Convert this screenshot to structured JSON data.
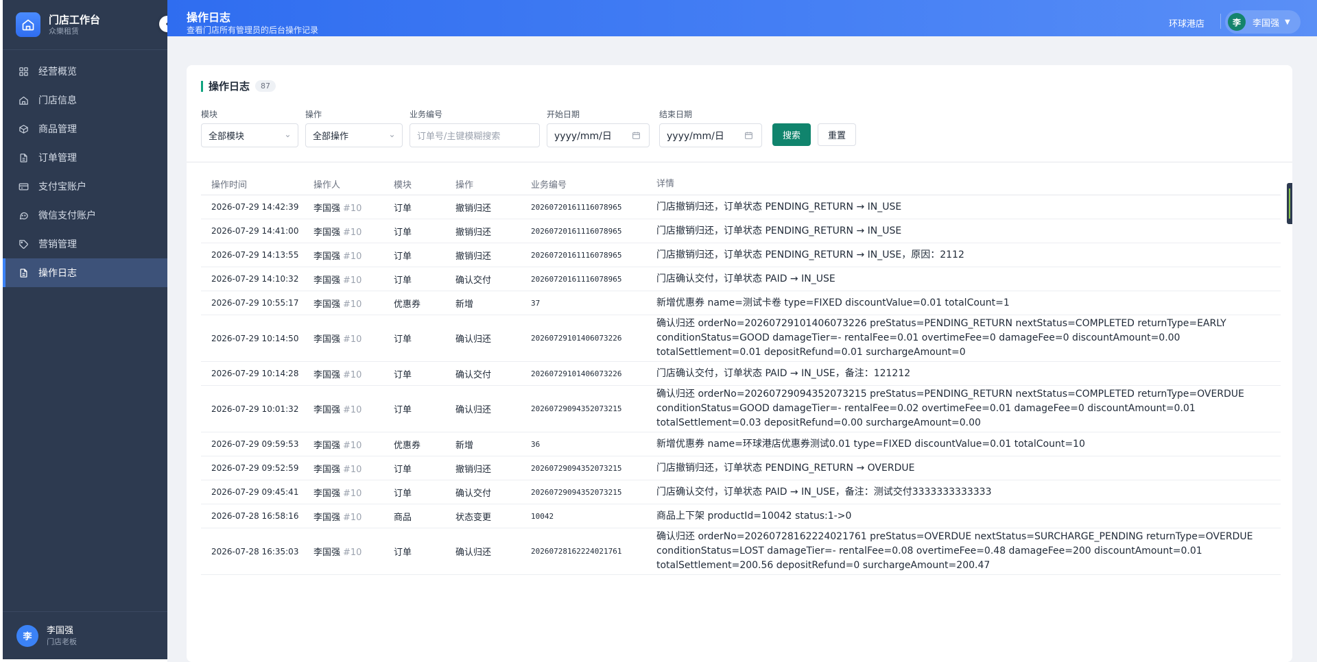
{
  "brand": {
    "title": "门店工作台",
    "subtitle": "众樂租赁"
  },
  "sidebar": {
    "items": [
      {
        "label": "经营概览",
        "icon": "grid-icon"
      },
      {
        "label": "门店信息",
        "icon": "home-icon"
      },
      {
        "label": "商品管理",
        "icon": "box-icon"
      },
      {
        "label": "订单管理",
        "icon": "document-icon"
      },
      {
        "label": "支付宝账户",
        "icon": "card-icon"
      },
      {
        "label": "微信支付账户",
        "icon": "chat-icon"
      },
      {
        "label": "营销管理",
        "icon": "tag-icon"
      },
      {
        "label": "操作日志",
        "icon": "log-icon",
        "active": true
      }
    ],
    "user": {
      "avatar": "李",
      "name": "李国强",
      "role": "门店老板"
    }
  },
  "header": {
    "title": "操作日志",
    "subtitle": "查看门店所有管理员的后台操作记录",
    "store": "环球港店",
    "user": {
      "avatar": "李",
      "name": "李国强",
      "caret": "▼"
    }
  },
  "card": {
    "title": "操作日志",
    "count": "87"
  },
  "filters": {
    "module": {
      "label": "模块",
      "value": "全部模块"
    },
    "action": {
      "label": "操作",
      "value": "全部操作"
    },
    "biz": {
      "label": "业务编号",
      "placeholder": "订单号/主键模糊搜索"
    },
    "start": {
      "label": "开始日期",
      "placeholder": "yyyy/mm/日"
    },
    "end": {
      "label": "结束日期",
      "placeholder": "yyyy/mm/日"
    },
    "search_label": "搜索",
    "reset_label": "重置"
  },
  "table": {
    "columns": [
      "操作时间",
      "操作人",
      "模块",
      "操作",
      "业务编号",
      "详情"
    ],
    "rows": [
      {
        "time": "2026-07-29 14:42:39",
        "operator": "李国强",
        "opid": "#10",
        "module": "订单",
        "action": "撤销归还",
        "biz": "20260720161116078965",
        "detail": "门店撤销归还，订单状态 PENDING_RETURN → IN_USE"
      },
      {
        "time": "2026-07-29 14:41:00",
        "operator": "李国强",
        "opid": "#10",
        "module": "订单",
        "action": "撤销归还",
        "biz": "20260720161116078965",
        "detail": "门店撤销归还，订单状态 PENDING_RETURN → IN_USE"
      },
      {
        "time": "2026-07-29 14:13:55",
        "operator": "李国强",
        "opid": "#10",
        "module": "订单",
        "action": "撤销归还",
        "biz": "20260720161116078965",
        "detail": "门店撤销归还，订单状态 PENDING_RETURN → IN_USE，原因：2112"
      },
      {
        "time": "2026-07-29 14:10:32",
        "operator": "李国强",
        "opid": "#10",
        "module": "订单",
        "action": "确认交付",
        "biz": "20260720161116078965",
        "detail": "门店确认交付，订单状态 PAID → IN_USE"
      },
      {
        "time": "2026-07-29 10:55:17",
        "operator": "李国强",
        "opid": "#10",
        "module": "优惠券",
        "action": "新增",
        "biz": "37",
        "detail": "新增优惠券 name=测试卡卷 type=FIXED discountValue=0.01 totalCount=1"
      },
      {
        "time": "2026-07-29 10:14:50",
        "operator": "李国强",
        "opid": "#10",
        "module": "订单",
        "action": "确认归还",
        "biz": "20260729101406073226",
        "detail": "确认归还 orderNo=20260729101406073226 preStatus=PENDING_RETURN nextStatus=COMPLETED returnType=EARLY conditionStatus=GOOD damageTier=- rentalFee=0.01 overtimeFee=0 damageFee=0 discountAmount=0.00 totalSettlement=0.01 depositRefund=0.01 surchargeAmount=0"
      },
      {
        "time": "2026-07-29 10:14:28",
        "operator": "李国强",
        "opid": "#10",
        "module": "订单",
        "action": "确认交付",
        "biz": "20260729101406073226",
        "detail": "门店确认交付，订单状态 PAID → IN_USE，备注：121212"
      },
      {
        "time": "2026-07-29 10:01:32",
        "operator": "李国强",
        "opid": "#10",
        "module": "订单",
        "action": "确认归还",
        "biz": "20260729094352073215",
        "detail": "确认归还 orderNo=20260729094352073215 preStatus=PENDING_RETURN nextStatus=COMPLETED returnType=OVERDUE conditionStatus=GOOD damageTier=- rentalFee=0.02 overtimeFee=0.01 damageFee=0 discountAmount=0.01 totalSettlement=0.03 depositRefund=0.00 surchargeAmount=0.00"
      },
      {
        "time": "2026-07-29 09:59:53",
        "operator": "李国强",
        "opid": "#10",
        "module": "优惠券",
        "action": "新增",
        "biz": "36",
        "detail": "新增优惠券 name=环球港店优惠券测试0.01 type=FIXED discountValue=0.01 totalCount=10"
      },
      {
        "time": "2026-07-29 09:52:59",
        "operator": "李国强",
        "opid": "#10",
        "module": "订单",
        "action": "撤销归还",
        "biz": "20260729094352073215",
        "detail": "门店撤销归还，订单状态 PENDING_RETURN → OVERDUE"
      },
      {
        "time": "2026-07-29 09:45:41",
        "operator": "李国强",
        "opid": "#10",
        "module": "订单",
        "action": "确认交付",
        "biz": "20260729094352073215",
        "detail": "门店确认交付，订单状态 PAID → IN_USE，备注：测试交付3333333333333"
      },
      {
        "time": "2026-07-28 16:58:16",
        "operator": "李国强",
        "opid": "#10",
        "module": "商品",
        "action": "状态变更",
        "biz": "10042",
        "detail": "商品上下架 productId=10042 status:1->0"
      },
      {
        "time": "2026-07-28 16:35:03",
        "operator": "李国强",
        "opid": "#10",
        "module": "订单",
        "action": "确认归还",
        "biz": "20260728162224021761",
        "detail": "确认归还 orderNo=20260728162224021761 preStatus=OVERDUE nextStatus=SURCHARGE_PENDING returnType=OVERDUE conditionStatus=LOST damageTier=- rentalFee=0.08 overtimeFee=0.48 damageFee=200 discountAmount=0.01 totalSettlement=200.56 depositRefund=0 surchargeAmount=200.47"
      }
    ]
  }
}
